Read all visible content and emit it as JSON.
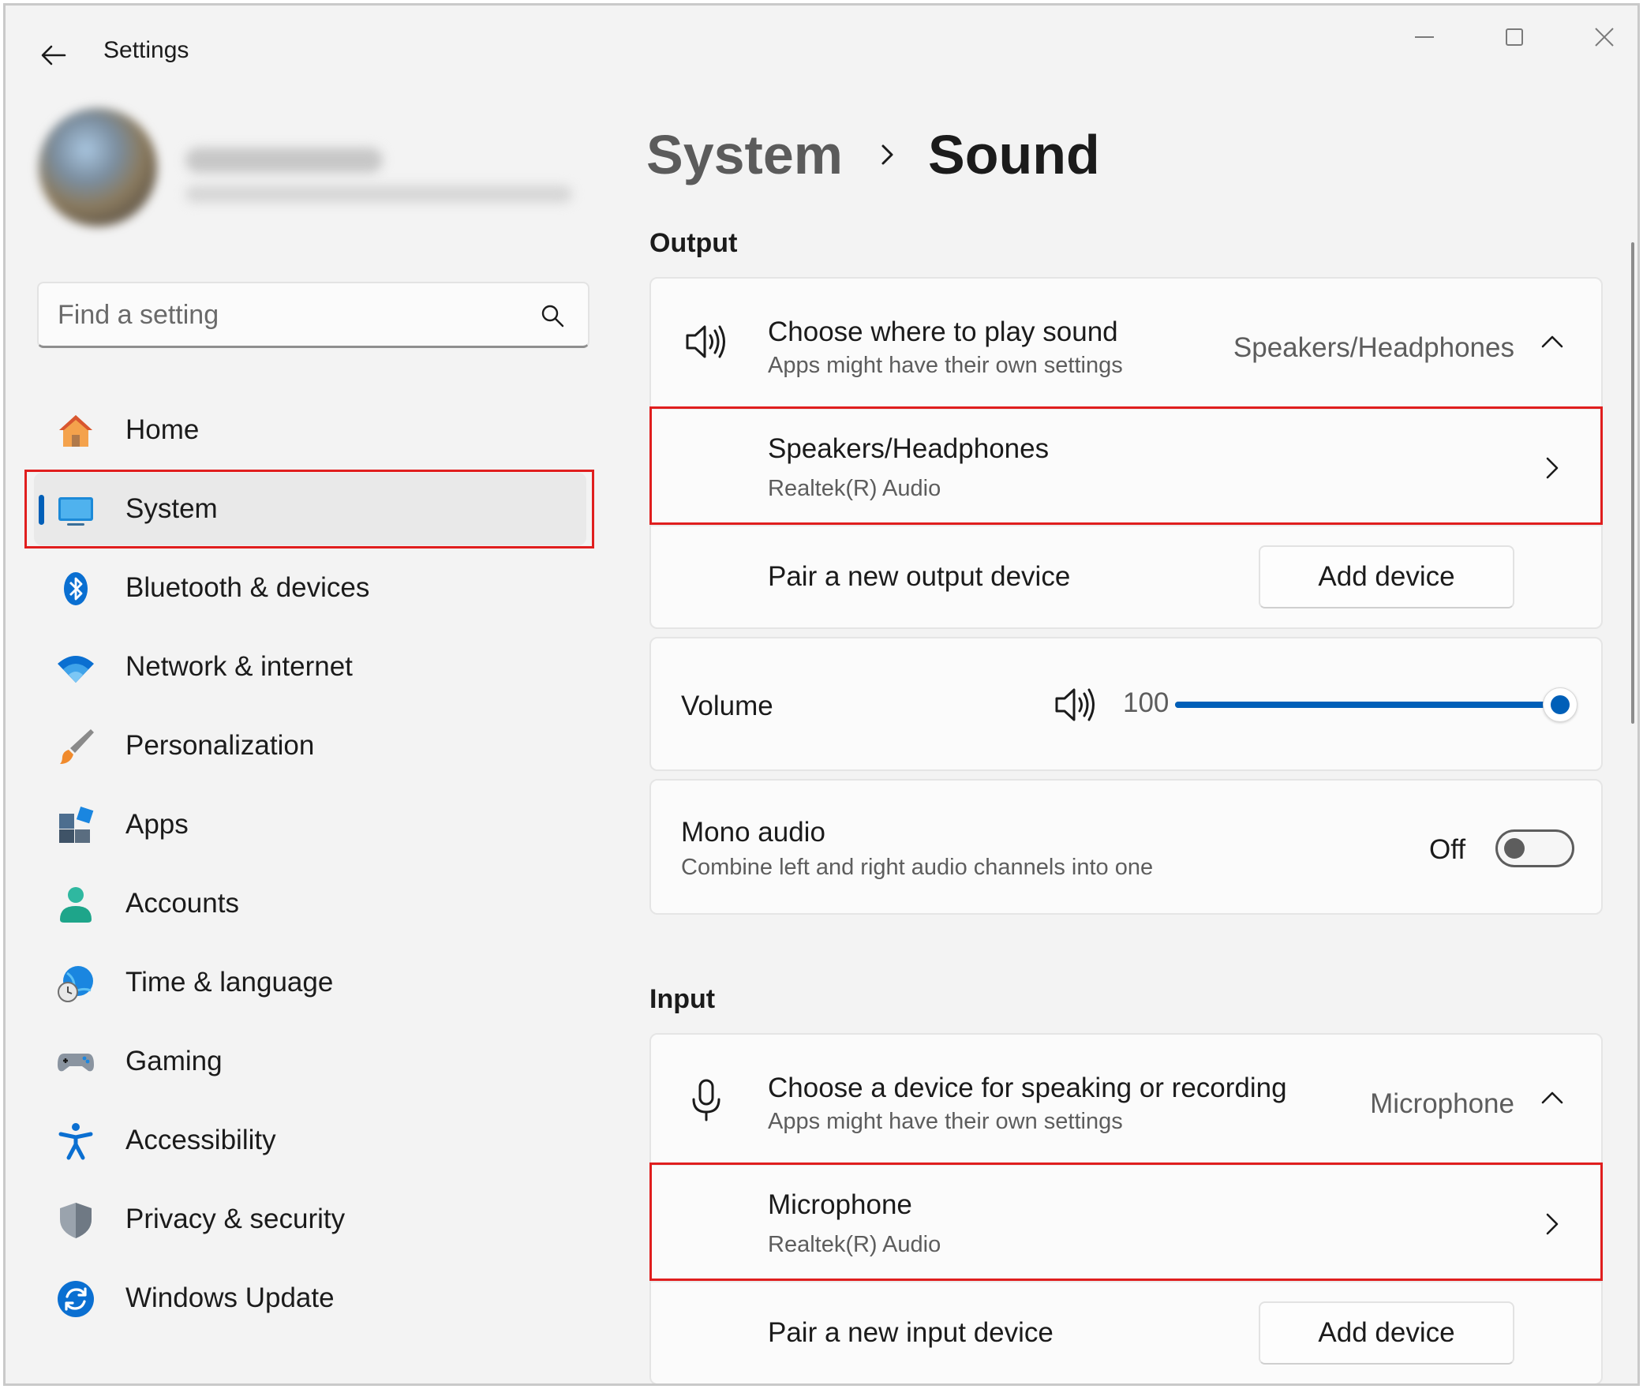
{
  "window": {
    "title": "Settings"
  },
  "search": {
    "placeholder": "Find a setting"
  },
  "nav": {
    "items": [
      {
        "label": "Home"
      },
      {
        "label": "System"
      },
      {
        "label": "Bluetooth & devices"
      },
      {
        "label": "Network & internet"
      },
      {
        "label": "Personalization"
      },
      {
        "label": "Apps"
      },
      {
        "label": "Accounts"
      },
      {
        "label": "Time & language"
      },
      {
        "label": "Gaming"
      },
      {
        "label": "Accessibility"
      },
      {
        "label": "Privacy & security"
      },
      {
        "label": "Windows Update"
      }
    ],
    "active_index": 1
  },
  "breadcrumb": {
    "parent": "System",
    "current": "Sound"
  },
  "output": {
    "section_title": "Output",
    "choose": {
      "title": "Choose where to play sound",
      "subtitle": "Apps might have their own settings",
      "value": "Speakers/Headphones"
    },
    "device": {
      "title": "Speakers/Headphones",
      "subtitle": "Realtek(R) Audio"
    },
    "pair": {
      "label": "Pair a new output device",
      "button": "Add device"
    },
    "volume": {
      "label": "Volume",
      "value": "100",
      "level_percent": 100
    },
    "mono": {
      "title": "Mono audio",
      "subtitle": "Combine left and right audio channels into one",
      "state": "Off"
    }
  },
  "input": {
    "section_title": "Input",
    "choose": {
      "title": "Choose a device for speaking or recording",
      "subtitle": "Apps might have their own settings",
      "value": "Microphone"
    },
    "device": {
      "title": "Microphone",
      "subtitle": "Realtek(R) Audio"
    },
    "pair": {
      "label": "Pair a new input device",
      "button": "Add device"
    }
  },
  "colors": {
    "accent": "#005fb8",
    "highlight": "#e01e1e"
  }
}
